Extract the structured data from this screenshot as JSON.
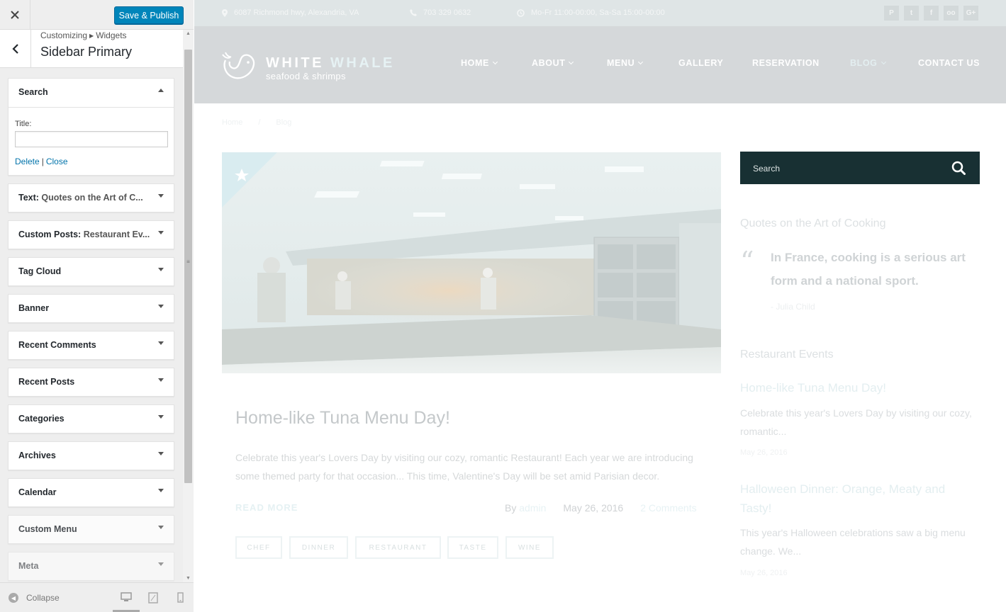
{
  "customizer": {
    "close_icon": "close-icon",
    "publish_label": "Save & Publish",
    "breadcrumb_root": "Customizing",
    "breadcrumb_child": "Widgets",
    "section_title": "Sidebar Primary",
    "search_widget": {
      "title": "Search",
      "field_label": "Title:",
      "field_value": "",
      "delete_label": "Delete",
      "separator": "|",
      "close_label": "Close"
    },
    "widgets": [
      {
        "name": "Text:",
        "sub": "Quotes on the Art of C..."
      },
      {
        "name": "Custom Posts:",
        "sub": "Restaurant Ev..."
      },
      {
        "name": "Tag Cloud",
        "sub": ""
      },
      {
        "name": "Banner",
        "sub": ""
      },
      {
        "name": "Recent Comments",
        "sub": ""
      },
      {
        "name": "Recent Posts",
        "sub": ""
      },
      {
        "name": "Categories",
        "sub": ""
      },
      {
        "name": "Archives",
        "sub": ""
      },
      {
        "name": "Calendar",
        "sub": ""
      },
      {
        "name": "Custom Menu",
        "sub": ""
      },
      {
        "name": "Meta",
        "sub": ""
      }
    ],
    "collapse_label": "Collapse"
  },
  "site": {
    "address": "6087 Richmond hwy, Alexandria, VA",
    "phone": "703 329 0632",
    "hours": "Mo-Fr 11:00-00:00, Sa-Sa 15:00-00:00",
    "social": [
      "P",
      "t",
      "f",
      "oo",
      "G+"
    ],
    "logo_word1": "WHITE",
    "logo_word2": "WHALE",
    "tagline": "seafood & shrimps",
    "nav": [
      {
        "label": "HOME",
        "dropdown": true
      },
      {
        "label": "ABOUT",
        "dropdown": true
      },
      {
        "label": "MENU",
        "dropdown": true
      },
      {
        "label": "GALLERY",
        "dropdown": false
      },
      {
        "label": "RESERVATION",
        "dropdown": false
      },
      {
        "label": "BLOG",
        "dropdown": true
      },
      {
        "label": "CONTACT US",
        "dropdown": false
      }
    ],
    "breadcrumb": {
      "home": "Home",
      "sep": "/",
      "current": "Blog"
    },
    "post": {
      "title": "Home-like Tuna Menu Day!",
      "excerpt": "Celebrate this year's Lovers Day by visiting our cozy, romantic Restaurant! Each year we are introducing some themed party for that occasion... This time, Valentine's Day will be set amid Parisian decor.",
      "read_more": "READ MORE",
      "by": "By",
      "author": "admin",
      "date": "May 26, 2016",
      "comments": "2 Comments",
      "tags": [
        "CHEF",
        "DINNER",
        "RESTAURANT",
        "TASTE",
        "WINE"
      ]
    },
    "sidebar": {
      "search_placeholder": "Search",
      "quotes_heading": "Quotes on the Art of Cooking",
      "quote": "In France, cooking is a serious art form and a national sport.",
      "quote_author": "- Julia Child",
      "events_heading": "Restaurant Events",
      "events": [
        {
          "title": "Home-like Tuna Menu Day!",
          "text": "Celebrate this year's Lovers Day by visiting our cozy, romantic...",
          "date": "May 26, 2016"
        },
        {
          "title": "Halloween Dinner: Orange, Meaty and Tasty!",
          "text": "This year's Halloween celebrations saw a big menu change. We...",
          "date": "May 26, 2016"
        }
      ]
    }
  },
  "colors": {
    "publish_button": "#0085ba",
    "link": "#0073aa",
    "search_box": "#183033"
  }
}
